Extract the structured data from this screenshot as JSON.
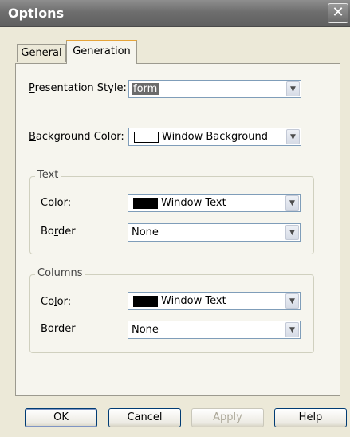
{
  "window": {
    "title": "Options"
  },
  "tabs": [
    {
      "label": "General"
    },
    {
      "label": "Generation"
    }
  ],
  "presentation_style": {
    "label": "Presentation Style:",
    "value": "form"
  },
  "background_color": {
    "label": "Background Color:",
    "value": "Window Background",
    "swatch": "#ffffff"
  },
  "text_group": {
    "caption": "Text",
    "color_label": "Color:",
    "color_value": "Window Text",
    "color_swatch": "#000000",
    "border_label": "Border",
    "border_value": "None"
  },
  "columns_group": {
    "caption": "Columns",
    "color_label": "Color:",
    "color_value": "Window Text",
    "color_swatch": "#000000",
    "border_label": "Border",
    "border_value": "None"
  },
  "buttons": {
    "ok": "OK",
    "cancel": "Cancel",
    "apply": "Apply",
    "help": "Help"
  }
}
